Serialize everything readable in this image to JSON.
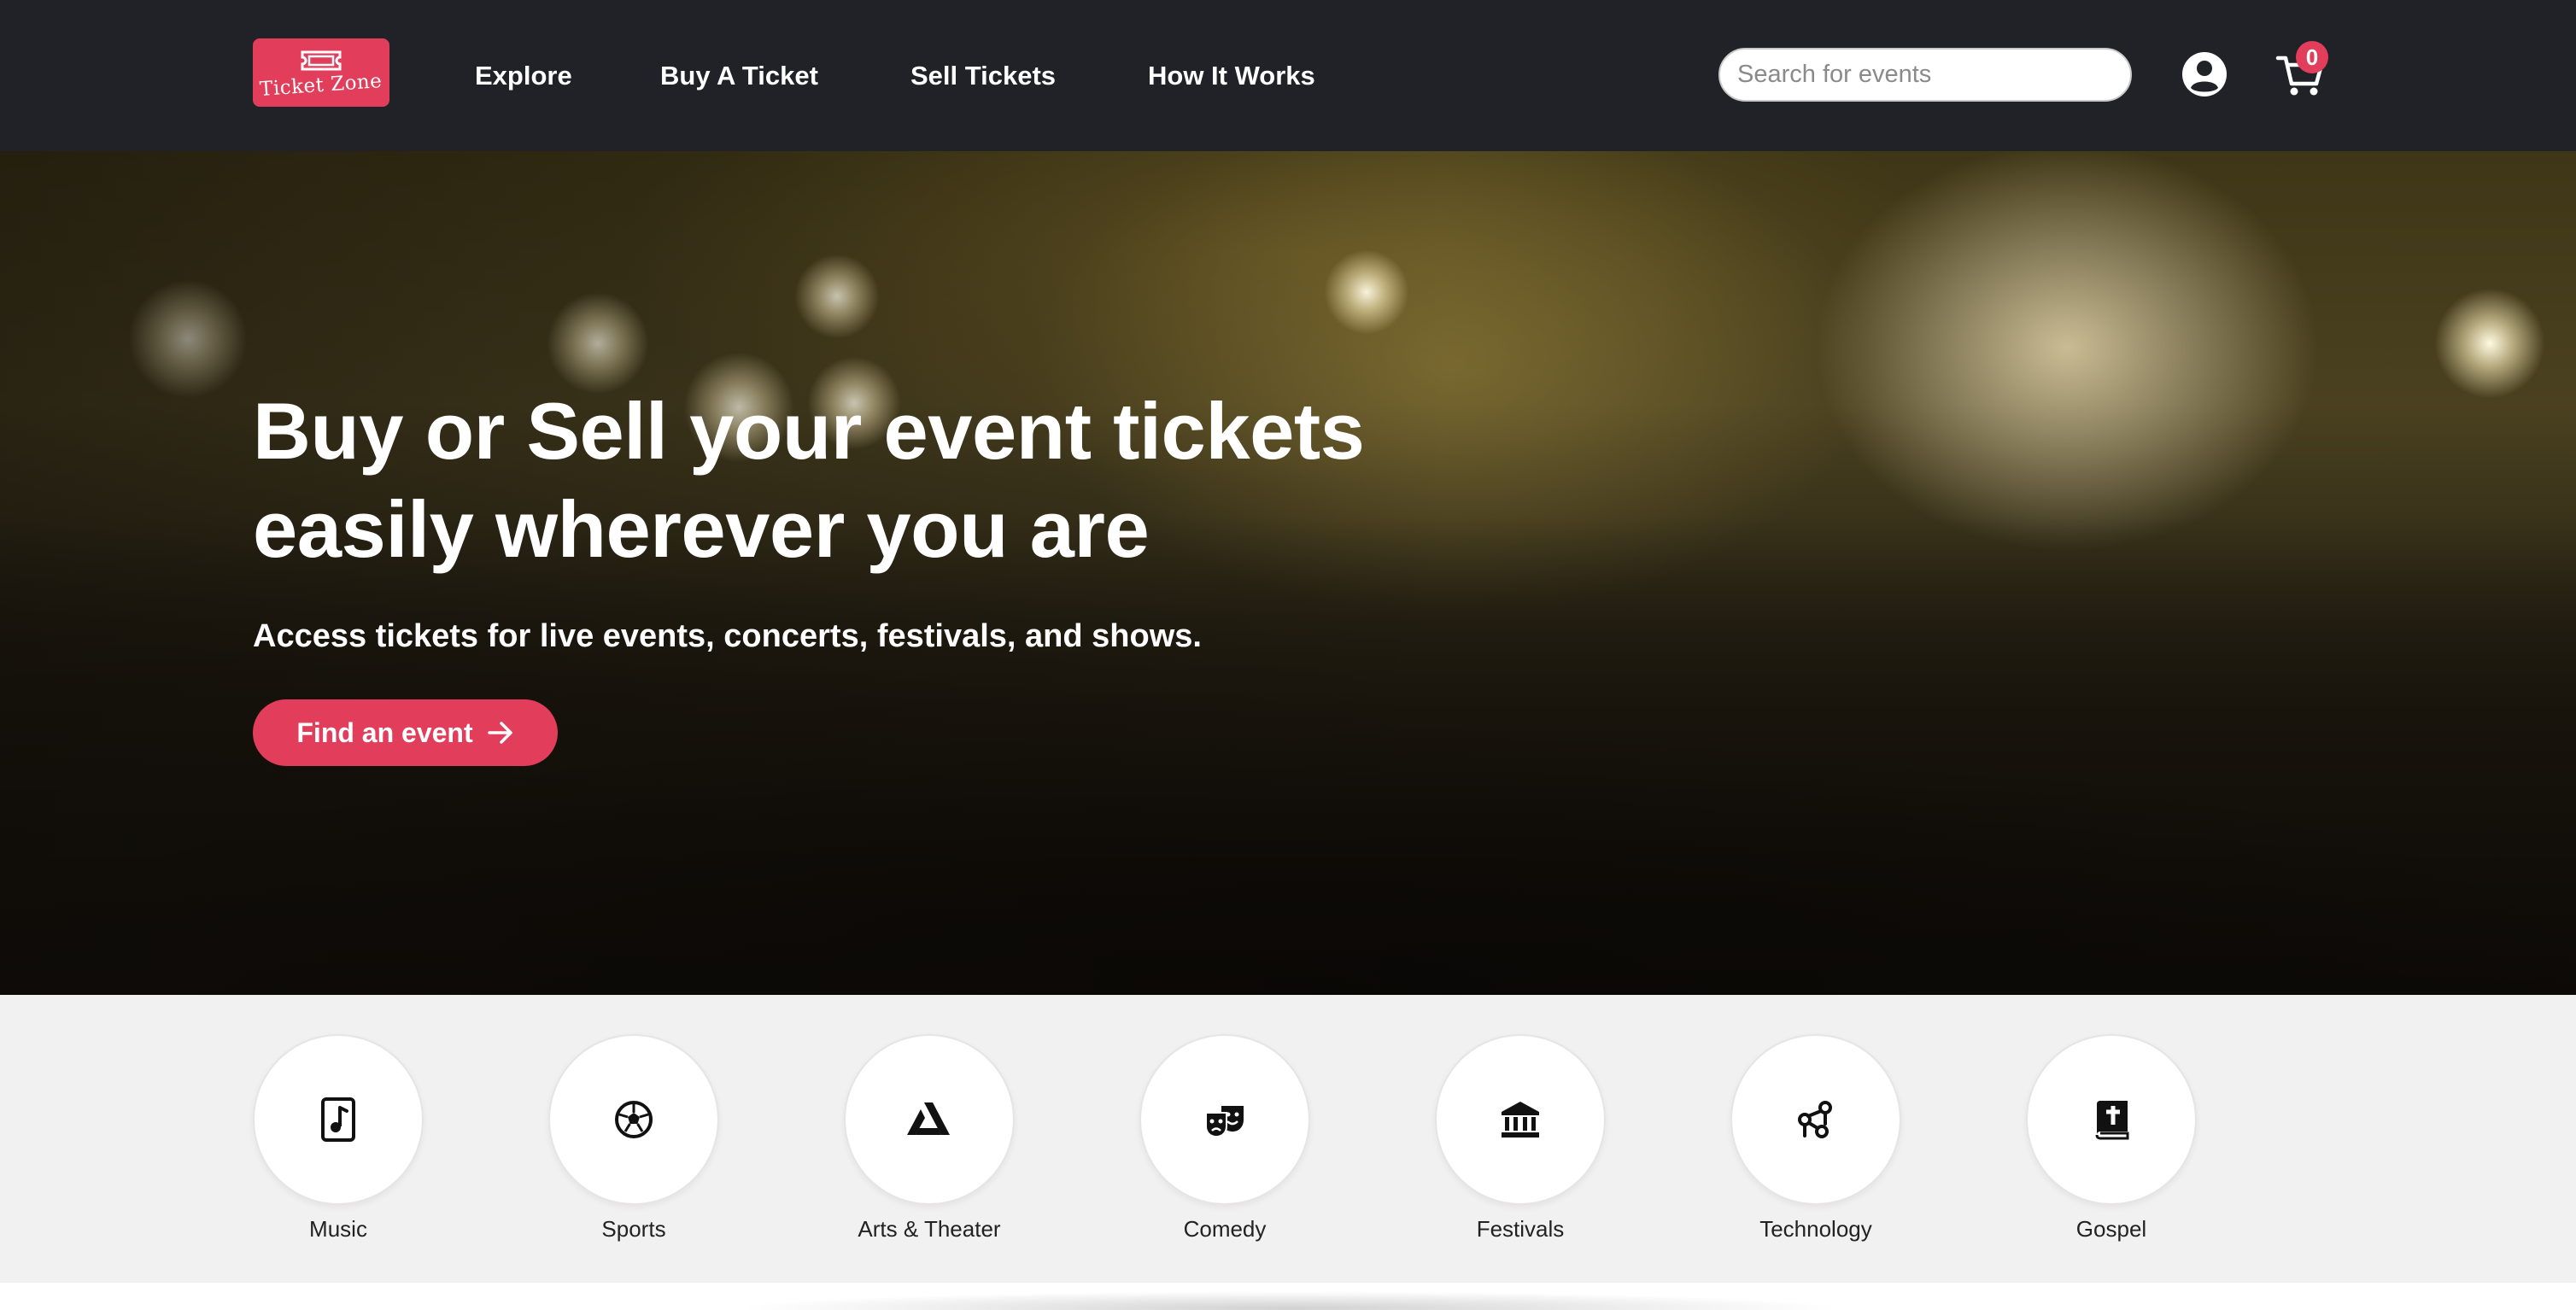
{
  "brand": {
    "logo_text": "Ticket Zone",
    "accent": "#e23d5a",
    "nav_bg": "#212227"
  },
  "nav": {
    "links": [
      "Explore",
      "Buy A Ticket",
      "Sell Tickets",
      "How It Works"
    ],
    "search_placeholder": "Search for events",
    "cart_count": "0",
    "icons": {
      "account": "user-circle-icon",
      "cart": "shopping-cart-icon"
    }
  },
  "hero": {
    "title_line1": "Buy or Sell your event tickets",
    "title_line2": "easily wherever you are",
    "subtitle": "Access tickets for live events, concerts, festivals, and shows.",
    "cta_label": "Find an event",
    "cta_icon": "arrow-right-icon"
  },
  "categories": [
    {
      "label": "Music",
      "icon": "music-note-icon"
    },
    {
      "label": "Sports",
      "icon": "soccer-ball-icon"
    },
    {
      "label": "Arts & Theater",
      "icon": "arts-icon"
    },
    {
      "label": "Comedy",
      "icon": "theater-masks-icon"
    },
    {
      "label": "Festivals",
      "icon": "landmark-icon"
    },
    {
      "label": "Technology",
      "icon": "circuit-icon"
    },
    {
      "label": "Gospel",
      "icon": "bible-icon"
    }
  ]
}
